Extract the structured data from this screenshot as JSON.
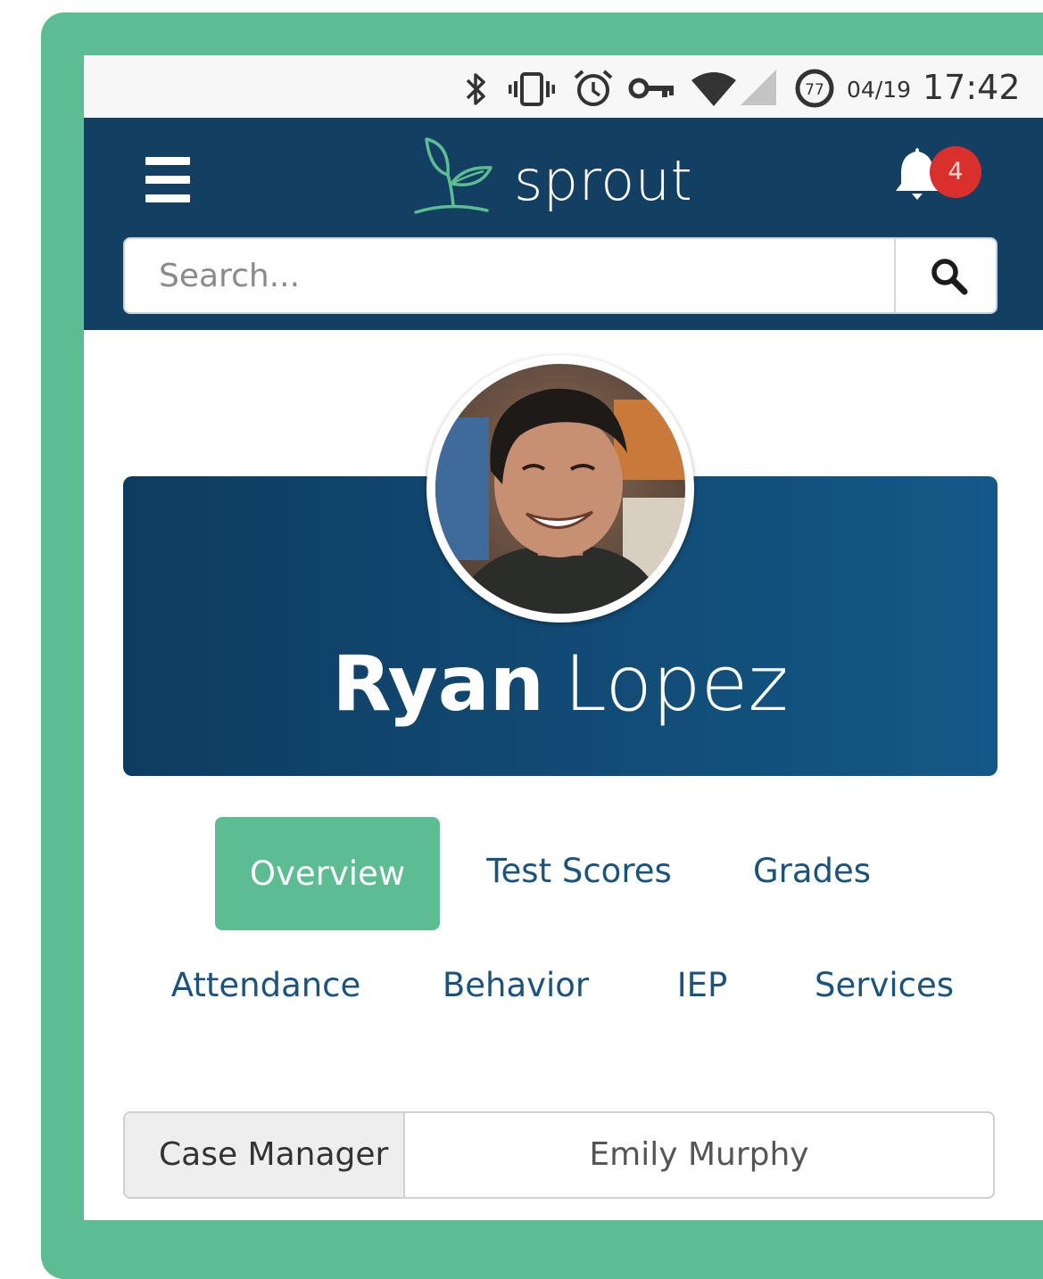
{
  "status_bar": {
    "battery_level": "77",
    "date": "04/19",
    "time": "17:42",
    "icons": [
      "bluetooth-icon",
      "vibrate-icon",
      "alarm-icon",
      "vpn-key-icon",
      "wifi-icon",
      "signal-icon",
      "battery-saver-icon"
    ]
  },
  "header": {
    "brand": "sprout",
    "notifications_count": "4",
    "menu_icon": "hamburger-menu-icon",
    "bell_icon": "bell-icon"
  },
  "search": {
    "placeholder": "Search...",
    "value": "",
    "button_icon": "search-icon"
  },
  "student": {
    "first_name": "Ryan",
    "last_name": "Lopez"
  },
  "tabs": [
    {
      "label": "Overview",
      "active": true
    },
    {
      "label": "Test Scores",
      "active": false
    },
    {
      "label": "Grades",
      "active": false
    },
    {
      "label": "Attendance",
      "active": false
    },
    {
      "label": "Behavior",
      "active": false
    },
    {
      "label": "IEP",
      "active": false
    },
    {
      "label": "Services",
      "active": false
    }
  ],
  "case_manager": {
    "label": "Case Manager",
    "value": "Emily Murphy"
  },
  "colors": {
    "frame_green": "#5bbd91",
    "navy": "#123f62",
    "tab_text": "#1a5380",
    "badge_red": "#d9302c"
  }
}
